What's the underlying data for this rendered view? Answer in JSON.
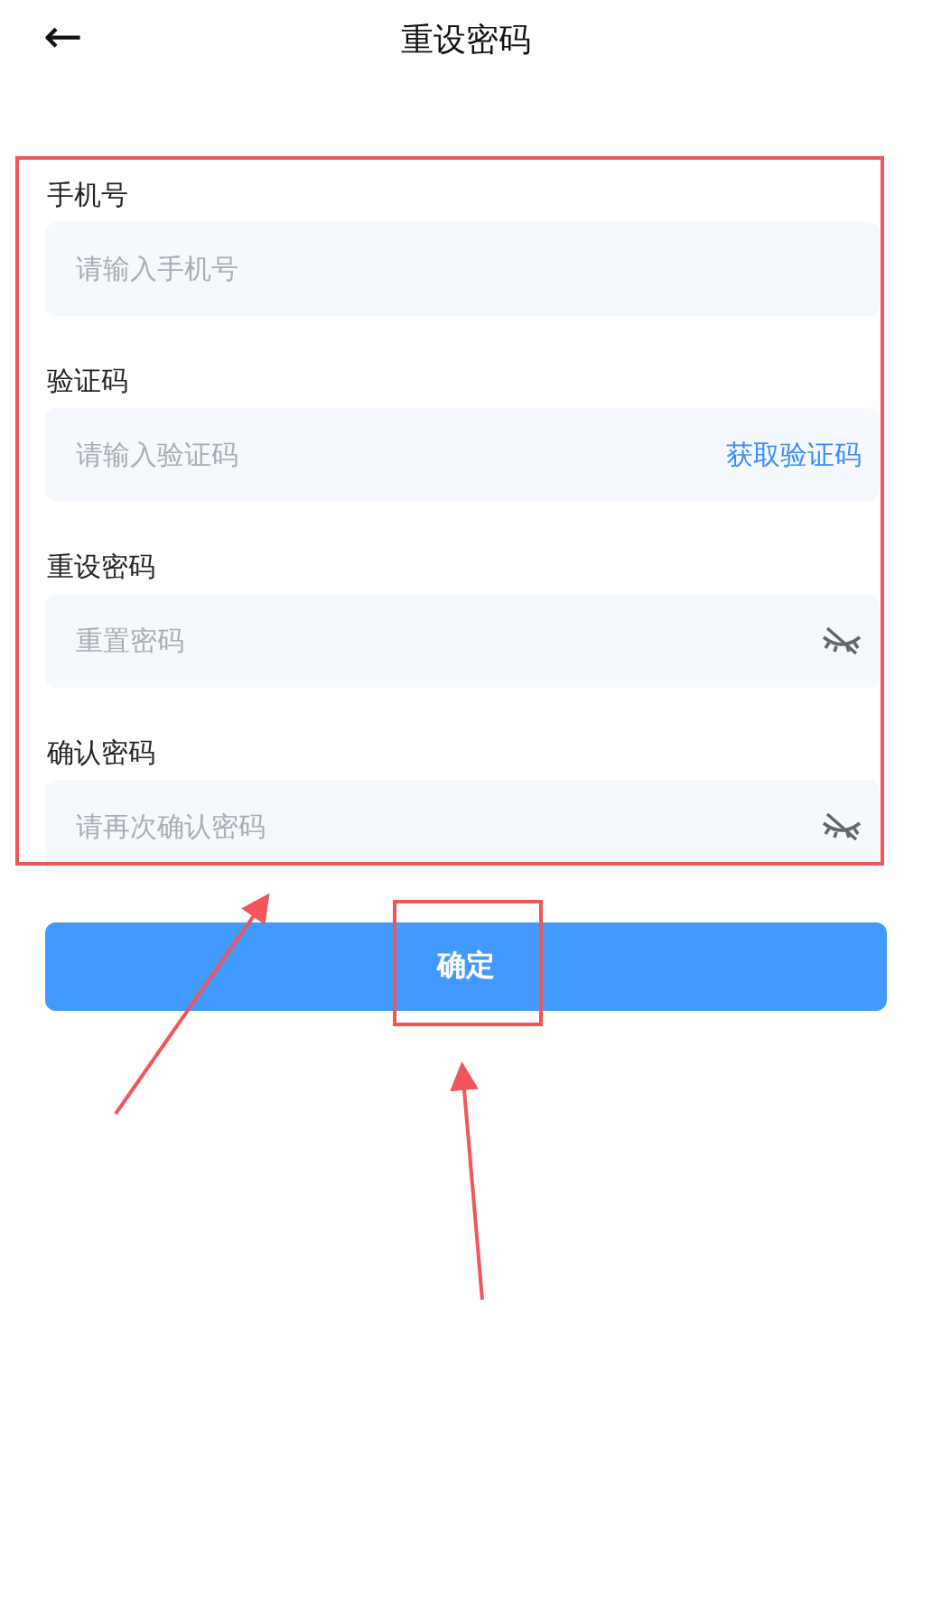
{
  "header": {
    "back": "←",
    "title": "重设密码"
  },
  "fields": [
    {
      "kind": "text",
      "label": "手机号",
      "placeholder": "请输入手机号"
    },
    {
      "kind": "code",
      "label": "验证码",
      "placeholder": "请输入验证码",
      "action": "获取验证码"
    },
    {
      "kind": "password",
      "label": "重设密码",
      "placeholder": "重置密码",
      "visible": false
    },
    {
      "kind": "password",
      "label": "确认密码",
      "placeholder": "请再次确认密码",
      "visible": false
    }
  ],
  "submit": "确定"
}
